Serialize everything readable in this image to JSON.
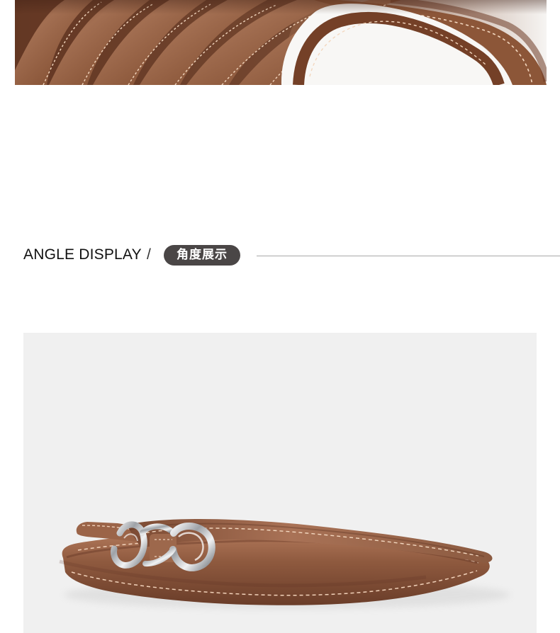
{
  "section": {
    "title_en": "ANGLE DISPLAY",
    "separator": "/",
    "title_cn": "角度展示"
  },
  "images": {
    "top": {
      "subject": "coiled-brown-leather-belt-closeup"
    },
    "main": {
      "subject": "brown-leather-belt-with-silver-buckle"
    }
  },
  "colors": {
    "leather": "#8d5a3f",
    "leather_dark": "#6f3f28",
    "stitch": "#f3d7bf",
    "buckle": "#d9dbde",
    "pill_bg": "#4a4646",
    "photo_bg": "#f0f0f0"
  }
}
